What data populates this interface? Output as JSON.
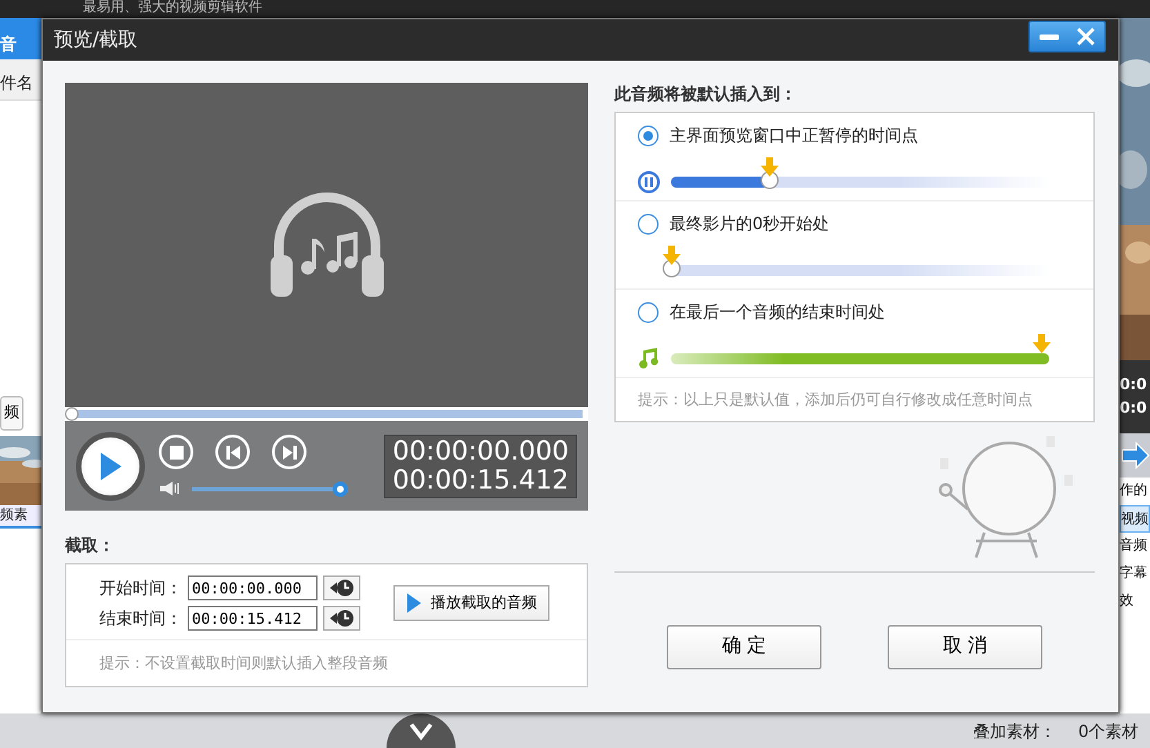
{
  "app": {
    "title": "最易用、强大的视频剪辑软件",
    "left_tab": "音",
    "column_header": "件名",
    "left_button": "频",
    "thumbnail_caption": "频素",
    "right_timecodes": [
      "0:0",
      "0:0"
    ],
    "right_heading": "作的",
    "right_items": [
      {
        "label": "视频",
        "selected": true
      },
      {
        "label": "音频",
        "selected": false
      },
      {
        "label": "字幕",
        "selected": false
      },
      {
        "label": "效",
        "selected": false
      }
    ],
    "overlay_label": "叠加素材：",
    "overlay_value": "0个素材"
  },
  "dialog": {
    "title": "预览/截取",
    "player": {
      "progress": {
        "level": 0
      },
      "volume": {
        "level": 1
      },
      "current_time": "00:00:00.000",
      "total_time": "00:00:15.412"
    },
    "clip": {
      "heading": "截取：",
      "start_label": "开始时间：",
      "start_value": "00:00:00.000",
      "end_label": "结束时间：",
      "end_value": "00:00:15.412",
      "play_button": "播放截取的音频",
      "hint": "提示：不设置截取时间则默认插入整段音频"
    },
    "insert": {
      "heading": "此音频将被默认插入到：",
      "options": [
        {
          "label": "主界面预览窗口中正暂停的时间点",
          "selected": true,
          "kind": "paused",
          "level": 0.26
        },
        {
          "label": "最终影片的0秒开始处",
          "selected": false,
          "kind": "start",
          "level": 0
        },
        {
          "label": "在最后一个音频的结束时间处",
          "selected": false,
          "kind": "end",
          "level": 1
        }
      ],
      "hint": "提示：以上只是默认值，添加后仍可自行修改成任意时间点"
    },
    "buttons": [
      "确 定",
      "取 消"
    ]
  }
}
